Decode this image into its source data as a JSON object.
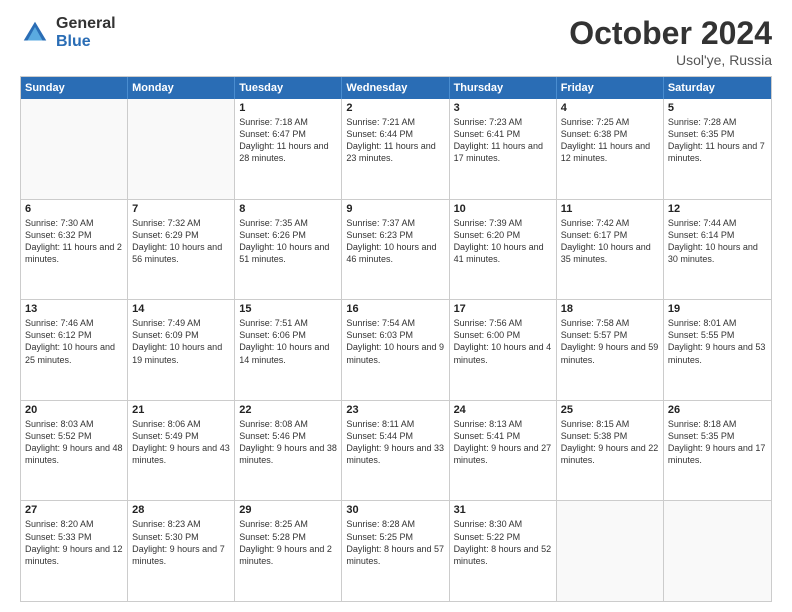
{
  "logo": {
    "general": "General",
    "blue": "Blue"
  },
  "header": {
    "month": "October 2024",
    "location": "Usol'ye, Russia"
  },
  "weekdays": [
    "Sunday",
    "Monday",
    "Tuesday",
    "Wednesday",
    "Thursday",
    "Friday",
    "Saturday"
  ],
  "rows": [
    [
      {
        "day": "",
        "empty": true
      },
      {
        "day": "",
        "empty": true
      },
      {
        "day": "1",
        "sunrise": "Sunrise: 7:18 AM",
        "sunset": "Sunset: 6:47 PM",
        "daylight": "Daylight: 11 hours and 28 minutes."
      },
      {
        "day": "2",
        "sunrise": "Sunrise: 7:21 AM",
        "sunset": "Sunset: 6:44 PM",
        "daylight": "Daylight: 11 hours and 23 minutes."
      },
      {
        "day": "3",
        "sunrise": "Sunrise: 7:23 AM",
        "sunset": "Sunset: 6:41 PM",
        "daylight": "Daylight: 11 hours and 17 minutes."
      },
      {
        "day": "4",
        "sunrise": "Sunrise: 7:25 AM",
        "sunset": "Sunset: 6:38 PM",
        "daylight": "Daylight: 11 hours and 12 minutes."
      },
      {
        "day": "5",
        "sunrise": "Sunrise: 7:28 AM",
        "sunset": "Sunset: 6:35 PM",
        "daylight": "Daylight: 11 hours and 7 minutes."
      }
    ],
    [
      {
        "day": "6",
        "sunrise": "Sunrise: 7:30 AM",
        "sunset": "Sunset: 6:32 PM",
        "daylight": "Daylight: 11 hours and 2 minutes."
      },
      {
        "day": "7",
        "sunrise": "Sunrise: 7:32 AM",
        "sunset": "Sunset: 6:29 PM",
        "daylight": "Daylight: 10 hours and 56 minutes."
      },
      {
        "day": "8",
        "sunrise": "Sunrise: 7:35 AM",
        "sunset": "Sunset: 6:26 PM",
        "daylight": "Daylight: 10 hours and 51 minutes."
      },
      {
        "day": "9",
        "sunrise": "Sunrise: 7:37 AM",
        "sunset": "Sunset: 6:23 PM",
        "daylight": "Daylight: 10 hours and 46 minutes."
      },
      {
        "day": "10",
        "sunrise": "Sunrise: 7:39 AM",
        "sunset": "Sunset: 6:20 PM",
        "daylight": "Daylight: 10 hours and 41 minutes."
      },
      {
        "day": "11",
        "sunrise": "Sunrise: 7:42 AM",
        "sunset": "Sunset: 6:17 PM",
        "daylight": "Daylight: 10 hours and 35 minutes."
      },
      {
        "day": "12",
        "sunrise": "Sunrise: 7:44 AM",
        "sunset": "Sunset: 6:14 PM",
        "daylight": "Daylight: 10 hours and 30 minutes."
      }
    ],
    [
      {
        "day": "13",
        "sunrise": "Sunrise: 7:46 AM",
        "sunset": "Sunset: 6:12 PM",
        "daylight": "Daylight: 10 hours and 25 minutes."
      },
      {
        "day": "14",
        "sunrise": "Sunrise: 7:49 AM",
        "sunset": "Sunset: 6:09 PM",
        "daylight": "Daylight: 10 hours and 19 minutes."
      },
      {
        "day": "15",
        "sunrise": "Sunrise: 7:51 AM",
        "sunset": "Sunset: 6:06 PM",
        "daylight": "Daylight: 10 hours and 14 minutes."
      },
      {
        "day": "16",
        "sunrise": "Sunrise: 7:54 AM",
        "sunset": "Sunset: 6:03 PM",
        "daylight": "Daylight: 10 hours and 9 minutes."
      },
      {
        "day": "17",
        "sunrise": "Sunrise: 7:56 AM",
        "sunset": "Sunset: 6:00 PM",
        "daylight": "Daylight: 10 hours and 4 minutes."
      },
      {
        "day": "18",
        "sunrise": "Sunrise: 7:58 AM",
        "sunset": "Sunset: 5:57 PM",
        "daylight": "Daylight: 9 hours and 59 minutes."
      },
      {
        "day": "19",
        "sunrise": "Sunrise: 8:01 AM",
        "sunset": "Sunset: 5:55 PM",
        "daylight": "Daylight: 9 hours and 53 minutes."
      }
    ],
    [
      {
        "day": "20",
        "sunrise": "Sunrise: 8:03 AM",
        "sunset": "Sunset: 5:52 PM",
        "daylight": "Daylight: 9 hours and 48 minutes."
      },
      {
        "day": "21",
        "sunrise": "Sunrise: 8:06 AM",
        "sunset": "Sunset: 5:49 PM",
        "daylight": "Daylight: 9 hours and 43 minutes."
      },
      {
        "day": "22",
        "sunrise": "Sunrise: 8:08 AM",
        "sunset": "Sunset: 5:46 PM",
        "daylight": "Daylight: 9 hours and 38 minutes."
      },
      {
        "day": "23",
        "sunrise": "Sunrise: 8:11 AM",
        "sunset": "Sunset: 5:44 PM",
        "daylight": "Daylight: 9 hours and 33 minutes."
      },
      {
        "day": "24",
        "sunrise": "Sunrise: 8:13 AM",
        "sunset": "Sunset: 5:41 PM",
        "daylight": "Daylight: 9 hours and 27 minutes."
      },
      {
        "day": "25",
        "sunrise": "Sunrise: 8:15 AM",
        "sunset": "Sunset: 5:38 PM",
        "daylight": "Daylight: 9 hours and 22 minutes."
      },
      {
        "day": "26",
        "sunrise": "Sunrise: 8:18 AM",
        "sunset": "Sunset: 5:35 PM",
        "daylight": "Daylight: 9 hours and 17 minutes."
      }
    ],
    [
      {
        "day": "27",
        "sunrise": "Sunrise: 8:20 AM",
        "sunset": "Sunset: 5:33 PM",
        "daylight": "Daylight: 9 hours and 12 minutes."
      },
      {
        "day": "28",
        "sunrise": "Sunrise: 8:23 AM",
        "sunset": "Sunset: 5:30 PM",
        "daylight": "Daylight: 9 hours and 7 minutes."
      },
      {
        "day": "29",
        "sunrise": "Sunrise: 8:25 AM",
        "sunset": "Sunset: 5:28 PM",
        "daylight": "Daylight: 9 hours and 2 minutes."
      },
      {
        "day": "30",
        "sunrise": "Sunrise: 8:28 AM",
        "sunset": "Sunset: 5:25 PM",
        "daylight": "Daylight: 8 hours and 57 minutes."
      },
      {
        "day": "31",
        "sunrise": "Sunrise: 8:30 AM",
        "sunset": "Sunset: 5:22 PM",
        "daylight": "Daylight: 8 hours and 52 minutes."
      },
      {
        "day": "",
        "empty": true
      },
      {
        "day": "",
        "empty": true
      }
    ]
  ]
}
